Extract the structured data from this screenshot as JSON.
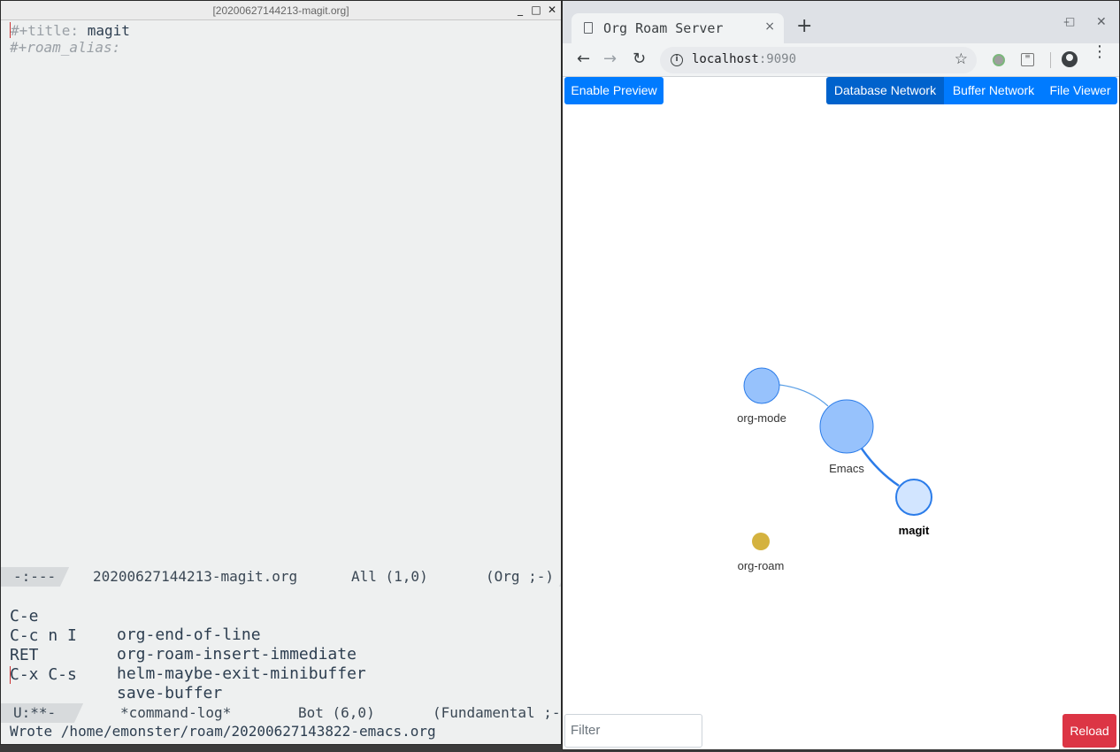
{
  "emacs": {
    "window_title": "[20200627144213-magit.org]",
    "controls": {
      "minimize": "_",
      "maximize": "□",
      "close": "✕"
    },
    "buffer": {
      "title_keyword": "#+title:",
      "title_value": " magit",
      "alias_keyword": "#+roam_alias:"
    },
    "modeline_top": {
      "status": "-:---",
      "buffer_name": "20200627144213-magit.org",
      "position": "All (1,0)",
      "mode": "(Org ;-)"
    },
    "command_log": [
      {
        "key": "C-e",
        "command": "org-end-of-line"
      },
      {
        "key": "C-c n I",
        "command": "org-roam-insert-immediate"
      },
      {
        "key": "RET",
        "command": "helm-maybe-exit-minibuffer"
      },
      {
        "key": "C-x C-s",
        "command": "save-buffer"
      }
    ],
    "modeline_bottom": {
      "status": "U:**-",
      "buffer_name": "*command-log*",
      "position": "Bot (6,0)",
      "mode": "(Fundamental ;-"
    },
    "echo_area": "Wrote /home/emonster/roam/20200627143822-emacs.org"
  },
  "browser": {
    "tab_title": "Org Roam Server",
    "tab_close": "×",
    "new_tab": "+",
    "window_controls": {
      "minimize": "–",
      "maximize": "□",
      "close": "✕"
    },
    "nav": {
      "back": "←",
      "forward": "→",
      "reload": "↻"
    },
    "url_host": "localhost",
    "url_port": ":9090",
    "star": "☆",
    "kebab": "⋮",
    "app": {
      "enable_preview": "Enable Preview",
      "nav_buttons": [
        "Database Network",
        "Buffer Network",
        "File Viewer"
      ],
      "active_nav": "Database Network",
      "filter_placeholder": "Filter",
      "reload_label": "Reload"
    },
    "graph": {
      "nodes": [
        {
          "id": "org-mode",
          "label": "org-mode",
          "color": "#97c2fc"
        },
        {
          "id": "emacs",
          "label": "Emacs",
          "color": "#97c2fc"
        },
        {
          "id": "magit",
          "label": "magit",
          "color": "#d2e5ff",
          "selected": true
        },
        {
          "id": "org-roam",
          "label": "org-roam",
          "color": "#d4b23f"
        }
      ],
      "edges": [
        {
          "from": "org-mode",
          "to": "emacs"
        },
        {
          "from": "emacs",
          "to": "magit",
          "highlighted": true
        }
      ]
    }
  }
}
